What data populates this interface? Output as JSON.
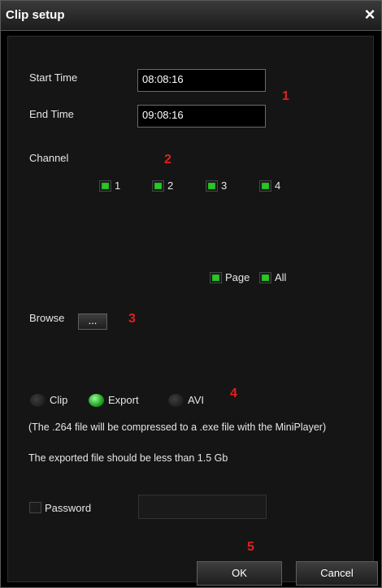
{
  "window": {
    "title": "Clip setup",
    "close_glyph": "×"
  },
  "time": {
    "start_label": "Start Time",
    "start_value": "08:08:16",
    "end_label": "End Time",
    "end_value": "09:08:16"
  },
  "channel": {
    "label": "Channel",
    "items": [
      {
        "label": "1",
        "checked": true
      },
      {
        "label": "2",
        "checked": true
      },
      {
        "label": "3",
        "checked": true
      },
      {
        "label": "4",
        "checked": true
      }
    ],
    "page_label": "Page",
    "all_label": "All"
  },
  "browse": {
    "label": "Browse",
    "button_label": "..."
  },
  "format": {
    "options": [
      {
        "label": "Clip",
        "selected": false
      },
      {
        "label": "Export",
        "selected": true
      },
      {
        "label": "AVI",
        "selected": false
      }
    ],
    "note1": "(The .264 file will be compressed to a .exe file with the MiniPlayer)",
    "note2": "The exported file should be less than 1.5 Gb"
  },
  "password": {
    "label": "Password",
    "value": ""
  },
  "buttons": {
    "ok": "OK",
    "cancel": "Cancel"
  },
  "markers": [
    "1",
    "2",
    "3",
    "4",
    "5"
  ],
  "colors": {
    "accent_green": "#2ec42e",
    "marker_red": "#e02020"
  }
}
